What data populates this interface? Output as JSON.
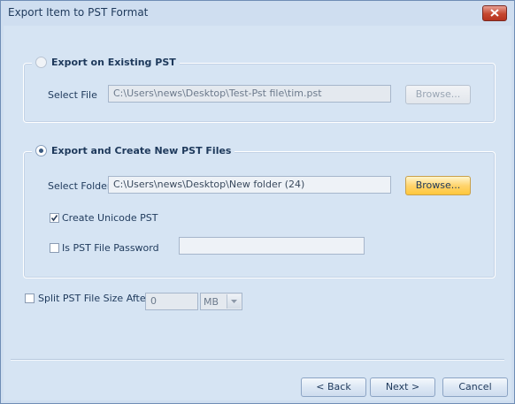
{
  "window": {
    "title": "Export Item to PST Format"
  },
  "existing": {
    "legend": "Export on Existing PST",
    "file_label": "Select File",
    "file_value": "C:\\Users\\news\\Desktop\\Test-Pst file\\tim.pst",
    "browse_label": "Browse..."
  },
  "create": {
    "legend": "Export and Create New  PST Files",
    "folder_label": "Select Folder",
    "folder_value": "C:\\Users\\news\\Desktop\\New folder (24)",
    "browse_label": "Browse...",
    "unicode_label": "Create Unicode PST",
    "unicode_checked": true,
    "password_label": "Is PST File Password",
    "password_checked": false,
    "password_value": ""
  },
  "split": {
    "label": "Split PST File Size After",
    "checked": false,
    "size_value": "0",
    "unit_value": "MB"
  },
  "footer": {
    "back_label": "< Back",
    "next_label": "Next >",
    "cancel_label": "Cancel"
  }
}
